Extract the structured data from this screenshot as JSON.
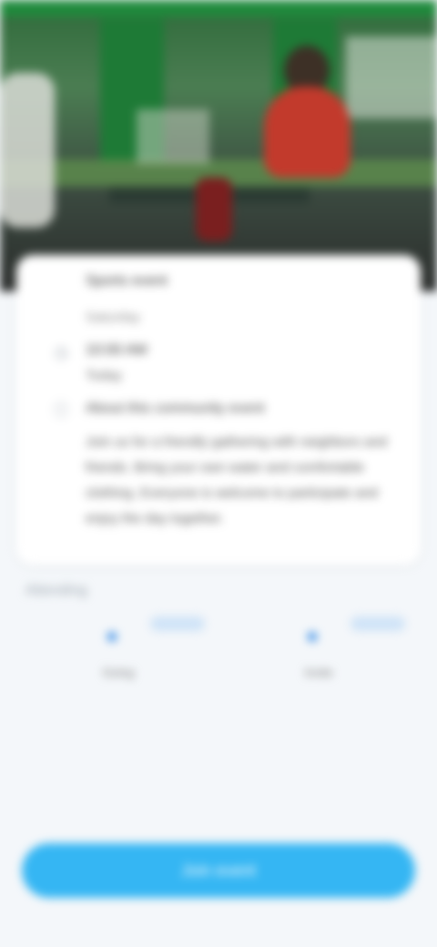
{
  "event": {
    "name_line1": "Sports event",
    "name_line2": "Saturday",
    "date_line1": "10:00 AM",
    "date_line2": "Today",
    "description_title": "About this community event",
    "description_body": "Join us for a friendly gathering with neighbors and friends. Bring your own water and comfortable clothing. Everyone is welcome to participate and enjoy the day together.",
    "icons": {
      "time": "clock-icon",
      "description": "info-icon"
    }
  },
  "actions_section": {
    "title": "Attending",
    "items": [
      {
        "label": "Going",
        "icon": "person-icon"
      },
      {
        "label": "Invite",
        "icon": "person-icon"
      }
    ]
  },
  "cta": {
    "label": "Join event",
    "color": "#35b6f3"
  }
}
